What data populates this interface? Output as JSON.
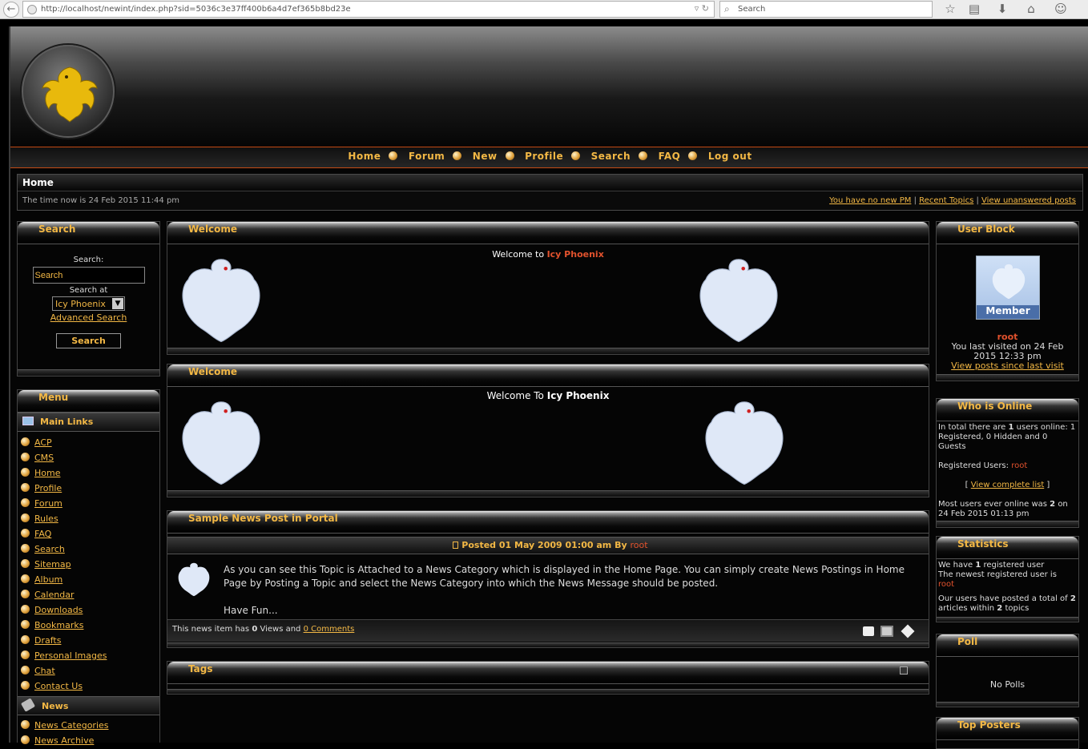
{
  "browser": {
    "url": "http://localhost/newint/index.php?sid=5036c3e37ff400b6a4d7ef365b8bd23e",
    "search_placeholder": "Search"
  },
  "nav": [
    "Home",
    "Forum",
    "New",
    "Profile",
    "Search",
    "FAQ",
    "Log out"
  ],
  "breadcrumb": {
    "title": "Home",
    "time": "The time now is 24 Feb 2015 11:44 pm",
    "links": [
      "You have no new PM",
      "Recent Topics",
      "View unanswered posts"
    ],
    "sep": "|"
  },
  "search_block": {
    "title": "Search",
    "label": "Search:",
    "input_value": "Search",
    "search_at": "Search at",
    "select_value": "Icy Phoenix",
    "advanced": "Advanced Search",
    "button": "Search"
  },
  "menu_block": {
    "title": "Menu",
    "main_links_title": "Main Links",
    "main_links": [
      "ACP",
      "CMS",
      "Home",
      "Profile",
      "Forum",
      "Rules",
      "FAQ",
      "Search",
      "Sitemap",
      "Album",
      "Calendar",
      "Downloads",
      "Bookmarks",
      "Drafts",
      "Personal Images",
      "Chat",
      "Contact Us"
    ],
    "news_title": "News",
    "news_links": [
      "News Categories",
      "News Archive"
    ]
  },
  "welcome1": {
    "title": "Welcome",
    "text_prefix": "Welcome to",
    "text_name": "Icy Phoenix"
  },
  "welcome2": {
    "title": "Welcome",
    "text_prefix": "Welcome To",
    "text_name": "Icy Phoenix"
  },
  "news": {
    "title": "Sample News Post in Portal",
    "posted_label": "Posted",
    "posted_date": "01 May 2009 01:00 am",
    "by": "By",
    "author": "root",
    "body1": "As you can see this Topic is Attached to a News Category which is displayed in the Home Page. You can simply create News Postings in Home Page by Posting a Topic and select the News Category into which the News Message should be posted.",
    "body2": "Have Fun...",
    "footer_prefix": "This news item has",
    "views": "0",
    "views_label": "Views and",
    "comments": "0 Comments"
  },
  "tags": {
    "title": "Tags"
  },
  "user_block": {
    "title": "User Block",
    "avatar_label": "Member",
    "username": "root",
    "last_visit": "You last visited on 24 Feb 2015 12:33 pm",
    "view_posts": "View posts since last visit"
  },
  "who_online": {
    "title": "Who is Online",
    "total_prefix": "In total there are",
    "total_count": "1",
    "total_suffix": "users online: 1 Registered, 0 Hidden and 0 Guests",
    "registered_label": "Registered Users:",
    "registered_user": "root",
    "complete_list": "View complete list",
    "most_prefix": "Most users ever online was",
    "most_count": "2",
    "most_suffix": "on 24 Feb 2015 01:13 pm"
  },
  "statistics": {
    "title": "Statistics",
    "we_have": "We have",
    "reg_count": "1",
    "reg_suffix": "registered user",
    "newest": "The newest registered user is",
    "newest_user": "root",
    "posted_prefix": "Our users have posted a total of",
    "articles": "2",
    "articles_mid": "articles within",
    "topics": "2",
    "topics_suffix": "topics"
  },
  "poll": {
    "title": "Poll",
    "text": "No Polls"
  },
  "top_posters": {
    "title": "Top Posters"
  },
  "colors": {
    "accent": "#f3b845",
    "username": "#e2522d",
    "nav_border": "#c34a14"
  }
}
